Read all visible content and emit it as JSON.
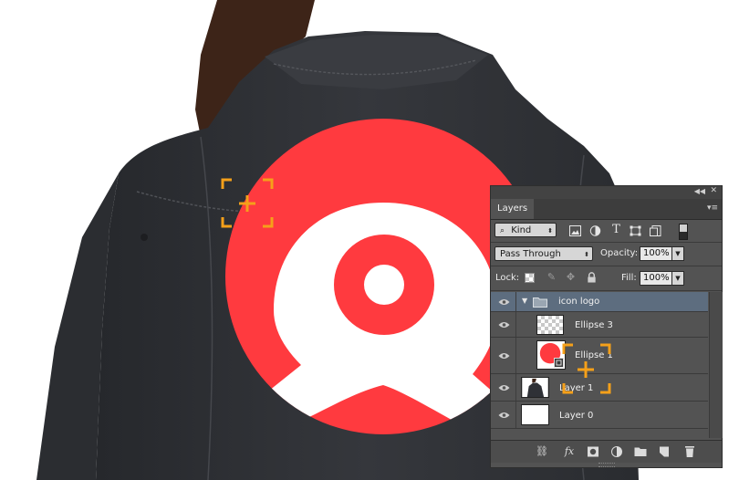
{
  "colors": {
    "logo_red": "#ff3a3f",
    "jacket": "#2f3136",
    "hair": "#3d2418",
    "marker_orange": "#f5a01a",
    "panel_bg": "#535353",
    "selected_row": "#5d6d7f"
  },
  "layers_panel": {
    "tab_label": "Layers",
    "filter": {
      "label": "Kind",
      "icons": [
        "pixel-filter-icon",
        "adjustment-filter-icon",
        "type-filter-icon",
        "shape-filter-icon",
        "smart-object-filter-icon"
      ]
    },
    "blend_mode": "Pass Through",
    "opacity_label": "Opacity:",
    "opacity_value": "100%",
    "lock_label": "Lock:",
    "fill_label": "Fill:",
    "fill_value": "100%",
    "layers": [
      {
        "name": "icon logo",
        "type": "group",
        "selected": true
      },
      {
        "name": "Ellipse 3",
        "type": "shape"
      },
      {
        "name": "Ellipse 1",
        "type": "shape"
      },
      {
        "name": "Layer 1",
        "type": "photo"
      },
      {
        "name": "Layer 0",
        "type": "fill"
      }
    ],
    "bottom_icons": [
      "link-icon",
      "fx-icon",
      "mask-icon",
      "adjustment-icon",
      "folder-icon",
      "new-layer-icon",
      "trash-icon"
    ],
    "fx_label": "fx"
  }
}
